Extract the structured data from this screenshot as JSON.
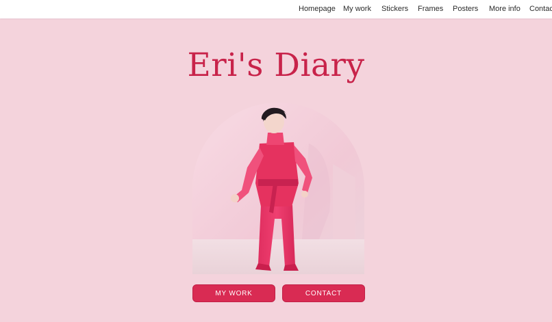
{
  "nav": {
    "items": [
      "Homepage",
      "My work",
      "Stickers",
      "Frames",
      "Posters",
      "More info",
      "Contact"
    ]
  },
  "hero": {
    "title": "Eri's Diary"
  },
  "buttons": {
    "my_work": "MY WORK",
    "contact": "CONTACT"
  },
  "colors": {
    "background": "#f4d3dc",
    "accent": "#d92b53",
    "title": "#c8234a",
    "outfit": "#e8386a"
  },
  "icons": {
    "hero_image": "person-in-pink-outfit"
  }
}
